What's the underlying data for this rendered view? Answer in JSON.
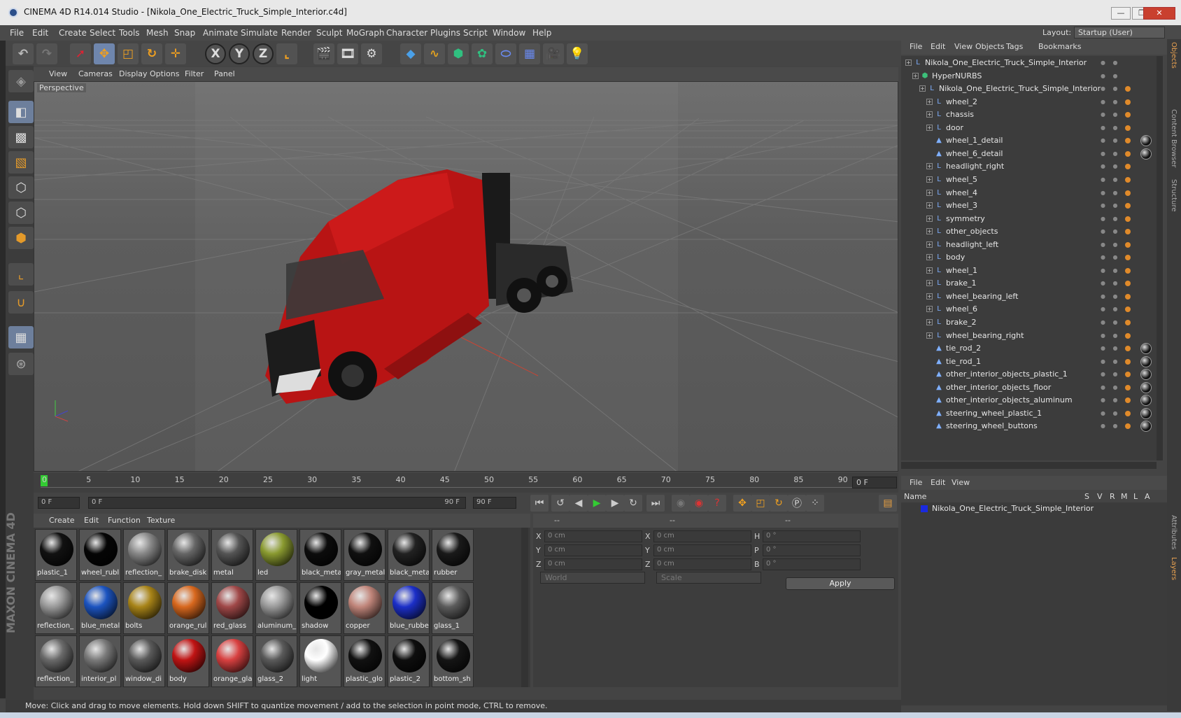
{
  "window": {
    "title": "CINEMA 4D R14.014 Studio - [Nikola_One_Electric_Truck_Simple_Interior.c4d]",
    "buttons": [
      "—",
      "❐",
      "✕"
    ]
  },
  "menubar": {
    "items": [
      "File",
      "Edit",
      "Create",
      "Select",
      "Tools",
      "Mesh",
      "Snap",
      "Animate",
      "Simulate",
      "Render",
      "Sculpt",
      "MoGraph",
      "Character",
      "Plugins",
      "Script",
      "Window",
      "Help"
    ],
    "layout_label": "Layout:",
    "layout_value": "Startup (User)"
  },
  "toolbar": {
    "axis_x": "X",
    "axis_y": "Y",
    "axis_z": "Z"
  },
  "viewport": {
    "menu": [
      "View",
      "Cameras",
      "Display",
      "Options",
      "Filter",
      "Panel"
    ],
    "label": "Perspective"
  },
  "timeline": {
    "ticks": [
      "0",
      "5",
      "10",
      "15",
      "20",
      "25",
      "30",
      "35",
      "40",
      "45",
      "50",
      "55",
      "60",
      "65",
      "70",
      "75",
      "80",
      "85",
      "90"
    ],
    "current_frame": "0 F",
    "start_field": "0 F",
    "range_start": "0 F",
    "range_end": "90 F",
    "end_field": "90 F"
  },
  "materials": {
    "menu": [
      "Create",
      "Edit",
      "Function",
      "Texture"
    ],
    "items": [
      {
        "name": "plastic_1",
        "color": "#111111"
      },
      {
        "name": "wheel_rubl",
        "color": "#050505"
      },
      {
        "name": "reflection_",
        "color": "#888888"
      },
      {
        "name": "brake_disk",
        "color": "#666666"
      },
      {
        "name": "metal",
        "color": "#555555"
      },
      {
        "name": "led",
        "color": "#8a9a30"
      },
      {
        "name": "black_meta",
        "color": "#0c0c0c"
      },
      {
        "name": "gray_metal",
        "color": "#101010"
      },
      {
        "name": "black_meta",
        "color": "#222222"
      },
      {
        "name": "rubber",
        "color": "#1a1a1a"
      },
      {
        "name": "reflection_",
        "color": "#9a9a9a"
      },
      {
        "name": "blue_metal",
        "color": "#1c54c0"
      },
      {
        "name": "bolts",
        "color": "#a88418"
      },
      {
        "name": "orange_rul",
        "color": "#d8681e"
      },
      {
        "name": "red_glass",
        "color": "#a04848"
      },
      {
        "name": "aluminum_",
        "color": "#9a9a9a"
      },
      {
        "name": "shadow",
        "color": "#000000"
      },
      {
        "name": "copper",
        "color": "#c0857a"
      },
      {
        "name": "blue_rubbe",
        "color": "#1c2fc8"
      },
      {
        "name": "glass_1",
        "color": "#5c5c5c"
      },
      {
        "name": "reflection_",
        "color": "#6a6a6a"
      },
      {
        "name": "interior_pl",
        "color": "#7a7a7a"
      },
      {
        "name": "window_di",
        "color": "#5a5a5a"
      },
      {
        "name": "body",
        "color": "#c01414"
      },
      {
        "name": "orange_gla",
        "color": "#d84040"
      },
      {
        "name": "glass_2",
        "color": "#5a5a5a"
      },
      {
        "name": "light",
        "color": "#ffffff"
      },
      {
        "name": "plastic_glo",
        "color": "#111111"
      },
      {
        "name": "plastic_2",
        "color": "#0e0e0e"
      },
      {
        "name": "bottom_sh",
        "color": "#151515"
      }
    ]
  },
  "coordinates": {
    "head": [
      "--",
      "--",
      "--"
    ],
    "rows": [
      {
        "a": "X",
        "av": "0 cm",
        "b": "X",
        "bv": "0 cm",
        "c": "H",
        "cv": "0 °"
      },
      {
        "a": "Y",
        "av": "0 cm",
        "b": "Y",
        "bv": "0 cm",
        "c": "P",
        "cv": "0 °"
      },
      {
        "a": "Z",
        "av": "0 cm",
        "b": "Z",
        "bv": "0 cm",
        "c": "B",
        "cv": "0 °"
      }
    ],
    "mode": "World",
    "scale": "Scale",
    "apply": "Apply"
  },
  "status": "Move: Click and drag to move elements. Hold down SHIFT to quantize movement / add to the selection in point mode, CTRL to remove.",
  "brand": "MAXON CINEMA 4D",
  "objects": {
    "menu": [
      "File",
      "Edit",
      "View",
      "Objects",
      "Tags",
      "Bookmarks"
    ],
    "rows": [
      {
        "name": "Nikola_One_Electric_Truck_Simple_Interior",
        "level": 0,
        "type": "null",
        "tag": false,
        "mat": false
      },
      {
        "name": "HyperNURBS",
        "level": 1,
        "type": "nurbs",
        "tag": false,
        "mat": false
      },
      {
        "name": "Nikola_One_Electric_Truck_Simple_Interior",
        "level": 2,
        "type": "null",
        "tag": true,
        "mat": false
      },
      {
        "name": "wheel_2",
        "level": 3,
        "type": "null",
        "tag": true,
        "mat": false
      },
      {
        "name": "chassis",
        "level": 3,
        "type": "null",
        "tag": true,
        "mat": false
      },
      {
        "name": "door",
        "level": 3,
        "type": "null",
        "tag": true,
        "mat": false
      },
      {
        "name": "wheel_1_detail",
        "level": 3,
        "type": "poly",
        "tag": true,
        "mat": true
      },
      {
        "name": "wheel_6_detail",
        "level": 3,
        "type": "poly",
        "tag": true,
        "mat": true
      },
      {
        "name": "headlight_right",
        "level": 3,
        "type": "null",
        "tag": true,
        "mat": false
      },
      {
        "name": "wheel_5",
        "level": 3,
        "type": "null",
        "tag": true,
        "mat": false
      },
      {
        "name": "wheel_4",
        "level": 3,
        "type": "null",
        "tag": true,
        "mat": false
      },
      {
        "name": "wheel_3",
        "level": 3,
        "type": "null",
        "tag": true,
        "mat": false
      },
      {
        "name": "symmetry",
        "level": 3,
        "type": "null",
        "tag": true,
        "mat": false
      },
      {
        "name": "other_objects",
        "level": 3,
        "type": "null",
        "tag": true,
        "mat": false
      },
      {
        "name": "headlight_left",
        "level": 3,
        "type": "null",
        "tag": true,
        "mat": false
      },
      {
        "name": "body",
        "level": 3,
        "type": "null",
        "tag": true,
        "mat": false
      },
      {
        "name": "wheel_1",
        "level": 3,
        "type": "null",
        "tag": true,
        "mat": false
      },
      {
        "name": "brake_1",
        "level": 3,
        "type": "null",
        "tag": true,
        "mat": false
      },
      {
        "name": "wheel_bearing_left",
        "level": 3,
        "type": "null",
        "tag": true,
        "mat": false
      },
      {
        "name": "wheel_6",
        "level": 3,
        "type": "null",
        "tag": true,
        "mat": false
      },
      {
        "name": "brake_2",
        "level": 3,
        "type": "null",
        "tag": true,
        "mat": false
      },
      {
        "name": "wheel_bearing_right",
        "level": 3,
        "type": "null",
        "tag": true,
        "mat": false
      },
      {
        "name": "tie_rod_2",
        "level": 3,
        "type": "poly",
        "tag": true,
        "mat": true
      },
      {
        "name": "tie_rod_1",
        "level": 3,
        "type": "poly",
        "tag": true,
        "mat": true
      },
      {
        "name": "other_interior_objects_plastic_1",
        "level": 3,
        "type": "poly",
        "tag": true,
        "mat": true
      },
      {
        "name": "other_interior_objects_floor",
        "level": 3,
        "type": "poly",
        "tag": true,
        "mat": true
      },
      {
        "name": "other_interior_objects_aluminum",
        "level": 3,
        "type": "poly",
        "tag": true,
        "mat": true
      },
      {
        "name": "steering_wheel_plastic_1",
        "level": 3,
        "type": "poly",
        "tag": true,
        "mat": true
      },
      {
        "name": "steering_wheel_buttons",
        "level": 3,
        "type": "poly",
        "tag": true,
        "mat": true
      }
    ]
  },
  "layers": {
    "menu": [
      "File",
      "Edit",
      "View"
    ],
    "headers": [
      "Name",
      "S",
      "V",
      "R",
      "M",
      "L",
      "A"
    ],
    "row": "Nikola_One_Electric_Truck_Simple_Interior",
    "row_color": "#1a2adf"
  },
  "right_tabs": [
    "Objects",
    "Content Browser",
    "Structure",
    "Attributes",
    "Layers"
  ]
}
